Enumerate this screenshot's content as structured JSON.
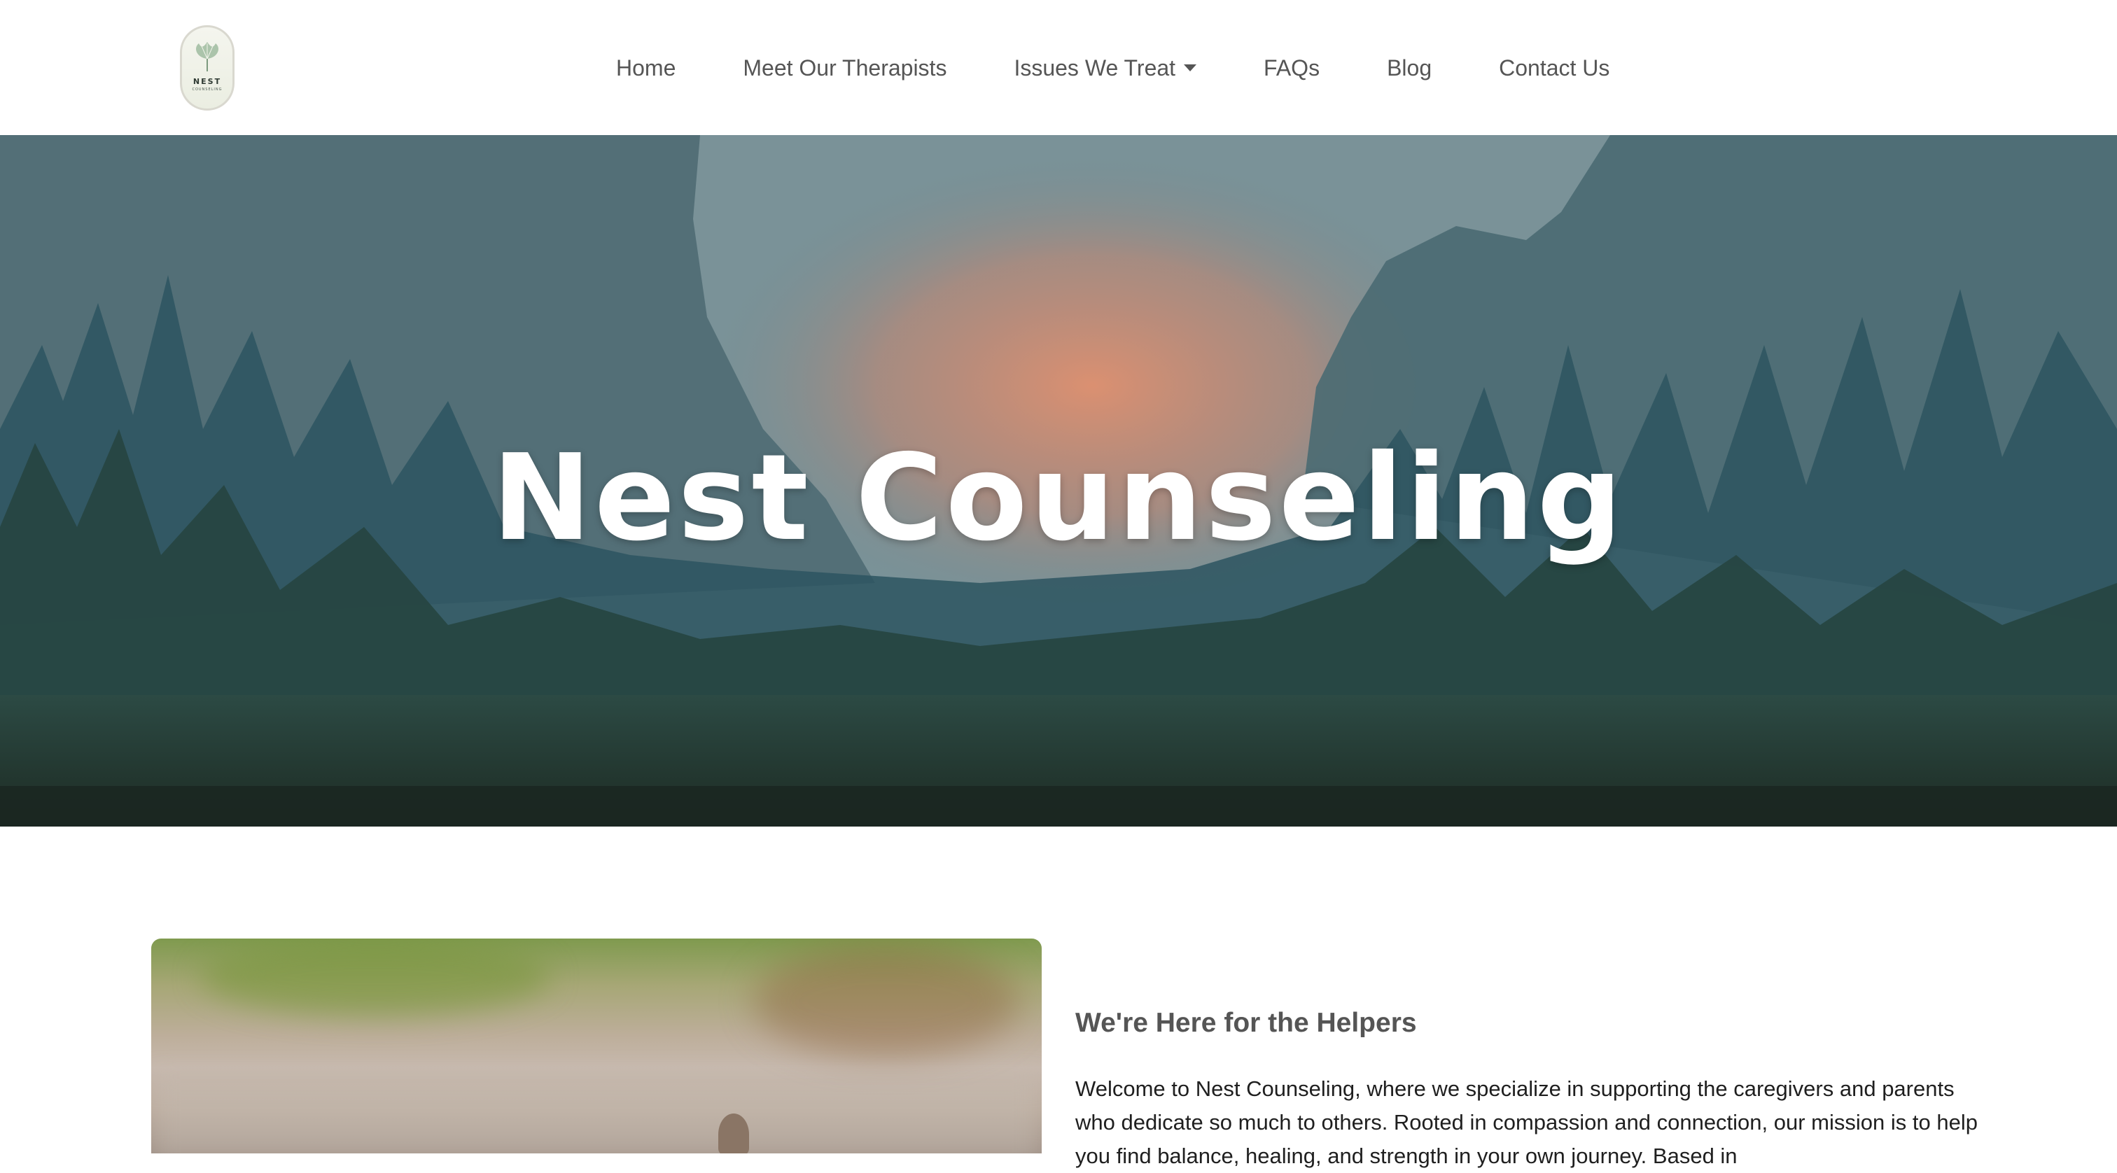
{
  "header": {
    "logo": {
      "name": "NEST",
      "subtitle": "COUNSELING"
    },
    "nav": [
      {
        "label": "Home"
      },
      {
        "label": "Meet Our Therapists"
      },
      {
        "label": "Issues We Treat"
      },
      {
        "label": "FAQs"
      },
      {
        "label": "Blog"
      },
      {
        "label": "Contact Us"
      }
    ]
  },
  "hero": {
    "title": "Nest Counseling"
  },
  "intro": {
    "heading": "We're Here for the Helpers",
    "body": "Welcome to Nest Counseling, where we specialize in supporting the caregivers and parents who dedicate so much to others. Rooted in compassion and connection, our mission is to help you find balance, healing, and strength in your own journey. Based in"
  },
  "colors": {
    "nav_text": "#555555",
    "hero_overlay": "#2f5561",
    "sky_glow": "#d98b6e",
    "heading_text": "#555555",
    "body_text": "#1f1f1f"
  },
  "icons": {
    "logo_mark": "ginkgo-leaf-icon",
    "dropdown": "caret-down-icon"
  }
}
